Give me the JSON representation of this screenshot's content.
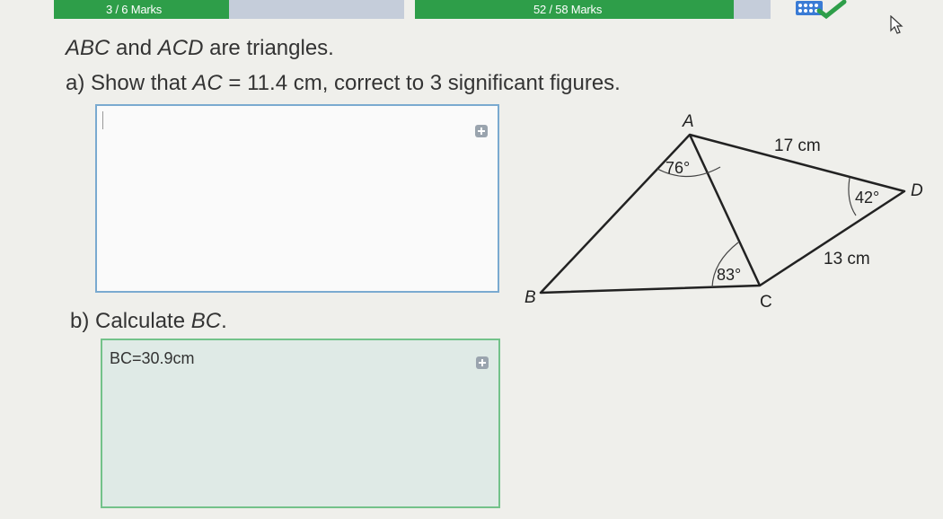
{
  "progress": {
    "question_marks": "3 / 6 Marks",
    "total_marks": "52 / 58 Marks",
    "question_fraction": 0.5,
    "total_fraction": 0.897
  },
  "question": {
    "intro": {
      "t1": "ABC",
      "t2": " and ",
      "t3": "ACD",
      "t4": " are triangles."
    },
    "part_a": {
      "label": "a)",
      "t1": " Show that ",
      "t2": "AC",
      "t3": " = 11.4 cm, correct to 3 significant figures."
    },
    "part_b": {
      "label": "b)",
      "t1": " Calculate ",
      "t2": "BC",
      "t3": "."
    }
  },
  "answers": {
    "a_value": "",
    "b_value": "BC=30.9cm"
  },
  "diagram": {
    "vertex_a": "A",
    "vertex_b": "B",
    "vertex_c": "C",
    "vertex_d": "D",
    "angle_a": "76°",
    "angle_c": "83°",
    "angle_d": "42°",
    "side_ad": "17 cm",
    "side_cd": "13 cm"
  },
  "colors": {
    "progress_green": "#2e9e49",
    "progress_track": "#c7cfdb",
    "box_a_border": "#6aa0c8",
    "box_b_fill": "#dde9e4",
    "box_b_border": "#6fbf85"
  },
  "icons": {
    "app_logo": "sparx-logo-icon",
    "cursor": "mouse-pointer-icon"
  }
}
